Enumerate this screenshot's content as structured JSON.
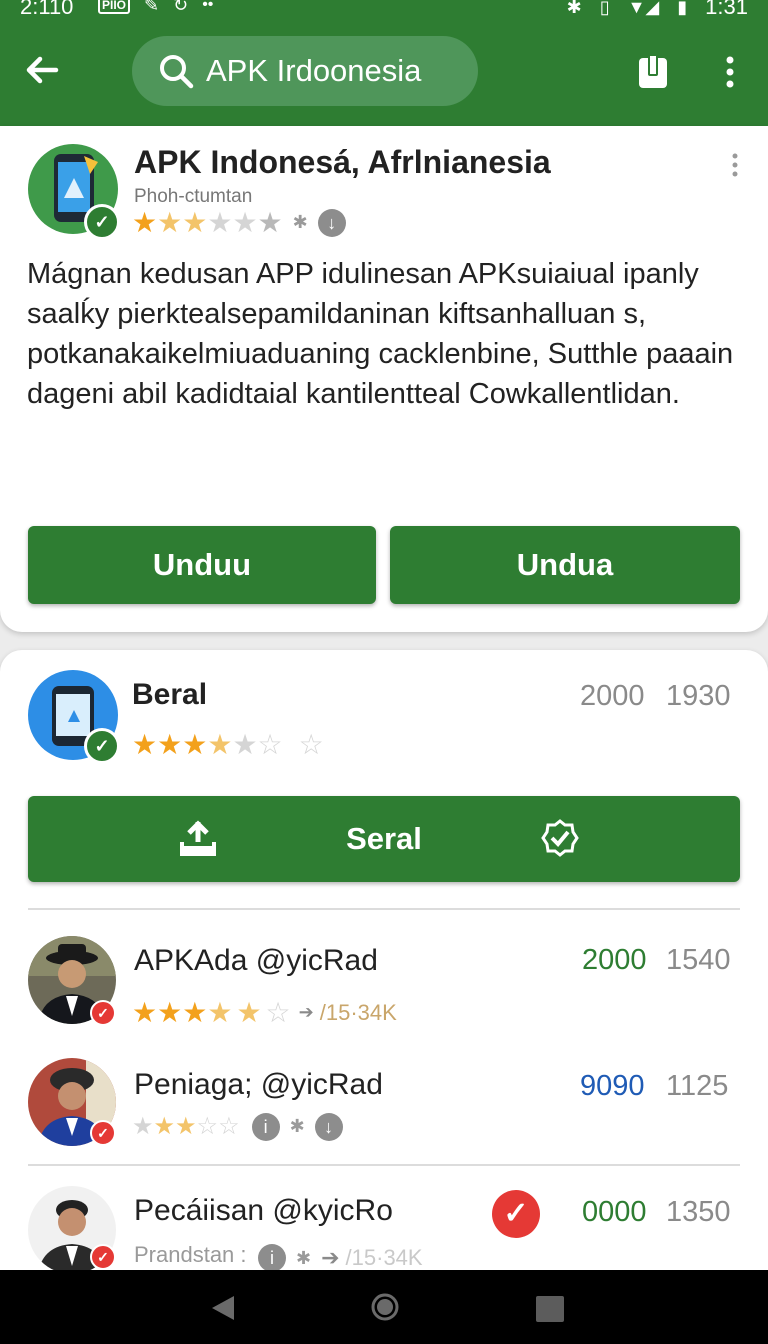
{
  "status_bar": {
    "time_left": "2:110",
    "badge_text": "PIIO",
    "time_right": "1:31"
  },
  "app_bar": {
    "search_text": "APK Irdoonesia"
  },
  "featured": {
    "title": "APK Indonesá, Afrlnianesia",
    "subtitle": "Phoh-ctumtan",
    "description": "Mágnan kedusan APP idulinesan APKsuiaiual ipanly saalḱy pierktealsepamildaninan kiftsanhalluan s, potkanakaikelmiuaduaning cacklenbine, Sutthle paaain dageni abil kadidtaial kantilentteal Cowkallentlidan.",
    "button_left": "Unduu",
    "button_right": "Undua"
  },
  "list": {
    "top_item": {
      "name": "Beral",
      "num_a": "2000",
      "num_b": "1930",
      "button_label": "Seral"
    },
    "items": [
      {
        "name": "APKAda @yicRad",
        "num_a": "2000",
        "num_b": "1540",
        "meta": "/15·34K",
        "num_color": "#2e7d32"
      },
      {
        "name": "Peniaga; @yicRad",
        "num_a": "9090",
        "num_b": "1125",
        "meta": "",
        "num_color": "#1f5bb5"
      },
      {
        "name": "Pecáiisan @kyicRo",
        "num_a": "0000",
        "num_b": "1350",
        "meta": "Prandstan :",
        "meta2": "/15·34K",
        "num_color": "#2e7d32"
      }
    ]
  },
  "colors": {
    "primary": "#2e7d32",
    "star": "#f3a11c",
    "badge_red": "#e53935"
  }
}
